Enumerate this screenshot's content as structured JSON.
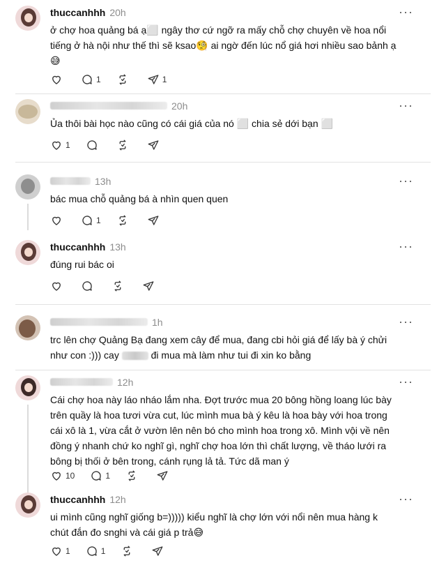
{
  "icons": {
    "like": "heart-outline",
    "reply": "speech-bubble",
    "repost": "repost-arrows",
    "share": "paper-plane",
    "more": "ellipsis"
  },
  "posts": [
    {
      "username": "thuccanhhh",
      "time": "20h",
      "text1": "ở chợ hoa quảng bá ạ⬜ ngây thơ cứ ngỡ ra mấy chỗ chợ chuyên về hoa nổi",
      "text2": "tiếng ở hà nội như thế thì sẽ ksao🧐 ai ngờ đến lúc nổ giá hơi nhiều sao bảnh ạ",
      "text3": "😅",
      "likes": "",
      "replies": "1",
      "reposts": "",
      "shares": "1"
    },
    {
      "username": "",
      "time": "20h",
      "text1": "Ủa thôi bài học nào cũng có cái giá của nó ⬜ chia sẻ dới bạn ⬜",
      "likes": "1",
      "replies": "",
      "reposts": "",
      "shares": ""
    },
    {
      "username": "",
      "time": "13h",
      "text1": "bác mua chỗ quảng bá à nhìn quen quen",
      "likes": "",
      "replies": "1",
      "reposts": "",
      "shares": ""
    },
    {
      "username": "thuccanhhh",
      "time": "13h",
      "text1": "đúng rui bác oi",
      "likes": "",
      "replies": "",
      "reposts": "",
      "shares": ""
    },
    {
      "username": "",
      "time": "1h",
      "text1": "trc lên chợ Quảng Bạ đang xem cây để mua, đang cbi hỏi giá để lấy bà ý chửi",
      "text2a": "như con :))) cay",
      "text2b": "đi mua mà làm như tui đi xin ko bằng",
      "likes": "",
      "replies": "",
      "reposts": "",
      "shares": ""
    },
    {
      "username": "",
      "time": "12h",
      "text1": "Cái chợ hoa này láo nháo lắm nha. Đợt trước mua 20 bông hồng loang lúc bày",
      "text2": "trên quầy là hoa tươi vừa cut, lúc mình mua bà ý kêu là hoa bày với hoa trong",
      "text3": "cái xô là 1, vừa cắt ở vườn lên nên bó cho mình hoa trong xô. Mình vội về nên",
      "text4": "đồng ý nhanh chứ ko nghĩ gì, nghĩ chợ hoa lớn thì chất lượng, về tháo lưới ra",
      "text5": "bông bị thối ở bên trong, cánh rụng lả tả. Tức dã man ý",
      "likes": "10",
      "replies": "1",
      "reposts": "",
      "shares": ""
    },
    {
      "username": "thuccanhhh",
      "time": "12h",
      "text1": "ui mình cũng nghĩ giống b=))))) kiểu nghĩ là chợ lớn với nổi nên mua hàng k",
      "text2": "chút đắn đo snghi và cái giá p trả😅",
      "likes": "1",
      "replies": "1",
      "reposts": "",
      "shares": ""
    }
  ],
  "more_label": "···"
}
